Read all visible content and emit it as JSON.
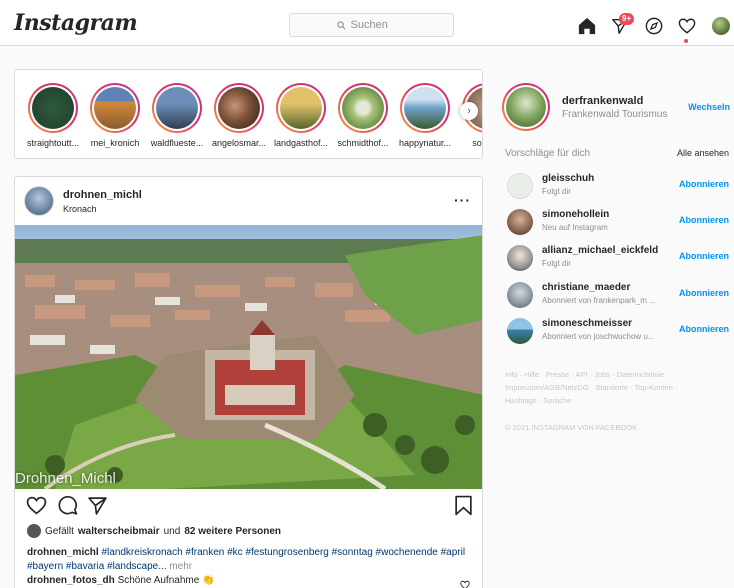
{
  "header": {
    "logo": "Instagram",
    "search_placeholder": "Suchen",
    "notification_badge": "9+"
  },
  "stories": [
    {
      "name": "straightoutt...",
      "colors": [
        "#2f5a3e",
        "#1e3d28"
      ]
    },
    {
      "name": "mei_kronich",
      "colors": [
        "#d38b3c",
        "#5f83b6"
      ]
    },
    {
      "name": "waldflueste...",
      "colors": [
        "#6c8fb9",
        "#2f3d52"
      ]
    },
    {
      "name": "angelosmar...",
      "colors": [
        "#7a5038",
        "#2c1d16"
      ]
    },
    {
      "name": "landgasthof...",
      "colors": [
        "#e0c16a",
        "#55652e"
      ]
    },
    {
      "name": "schmidthof...",
      "colors": [
        "#a6c47a",
        "#3f6424"
      ]
    },
    {
      "name": "happynatur...",
      "colors": [
        "#6e9fc8",
        "#3a5a2a"
      ]
    },
    {
      "name": "somme",
      "colors": [
        "#c9a184",
        "#6b5748"
      ]
    }
  ],
  "post": {
    "username": "drohnen_michl",
    "location": "Kronach",
    "watermark": "Drohnen_Michl",
    "liked_by_prefix": "Gefällt",
    "liked_by_user": "walterscheibmair",
    "liked_by_suffix": "und",
    "liked_by_count": "82 weitere Personen",
    "caption_user": "drohnen_michl",
    "caption_tags": "#landkreiskronach #franken #kc #festungrosenberg #sonntag #wochenende #april #bayern #bavaria #landscape...",
    "caption_more": "mehr",
    "comment_user": "drohnen_fotos_dh",
    "comment_text": "Schöne Aufnahme 👏"
  },
  "sidebar": {
    "username": "derfrankenwald",
    "name": "Frankenwald Tourismus",
    "switch_label": "Wechseln",
    "suggestions_title": "Vorschläge für dich",
    "see_all": "Alle ansehen",
    "follow_label": "Abonnieren",
    "suggestions": [
      {
        "user": "gleisschuh",
        "sub": "Folgt dir",
        "color": "#e9efe7"
      },
      {
        "user": "simonehollein",
        "sub": "Neu auf Instagram",
        "color": "#8a6a55"
      },
      {
        "user": "allianz_michael_eickfeld",
        "sub": "Folgt dir",
        "color": "#5b5b5b"
      },
      {
        "user": "christiane_maeder",
        "sub": "Abonniert von frankenpark_m ...",
        "color": "#8f9aa5"
      },
      {
        "user": "simoneschmeisser",
        "sub": "Abonniert von joschwuchow u...",
        "color": "#3e7fb1"
      }
    ],
    "footer_links": "Info · Hilfe · Presse · API · Jobs · Datenrichtlinie · Impressum/AGB/NetzDG · Standorte · Top-Konten · Hashtags · Sprache",
    "copyright": "© 2021 INSTAGRAM VON FACEBOOK"
  }
}
